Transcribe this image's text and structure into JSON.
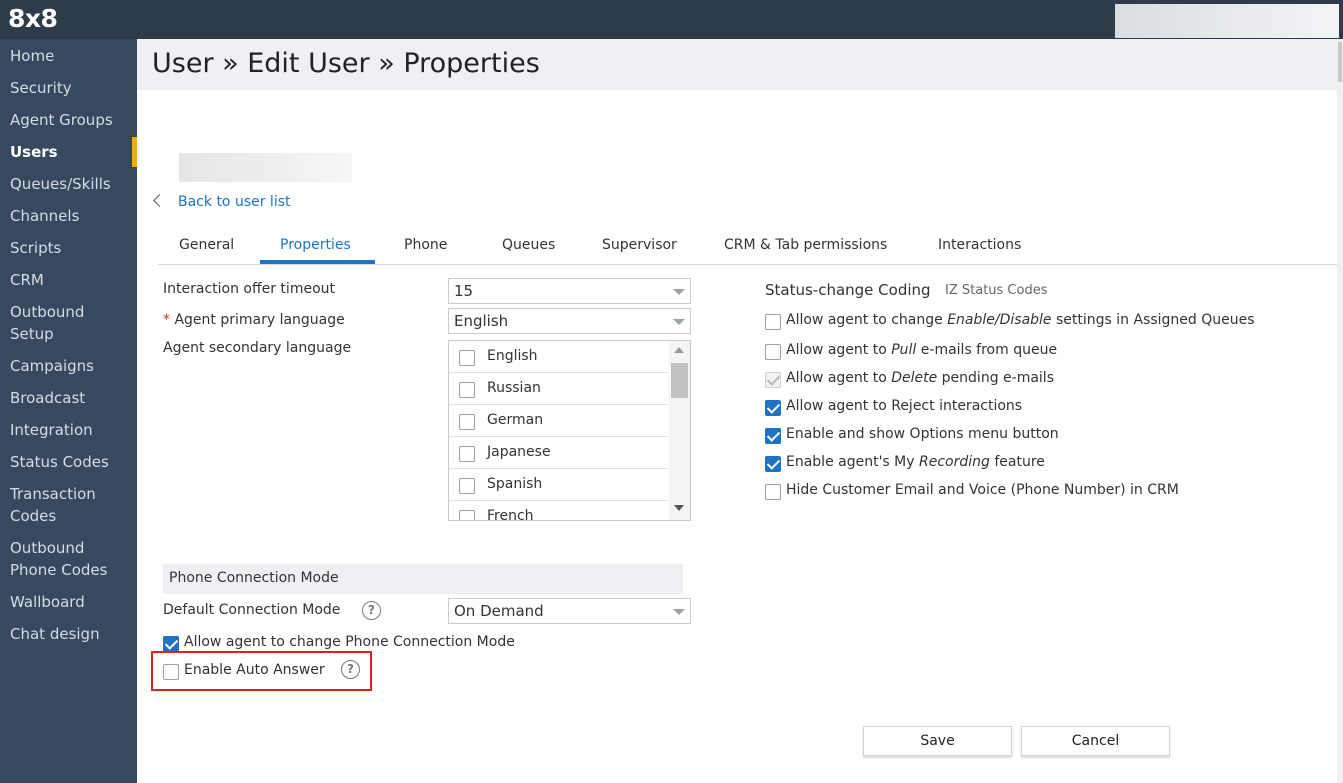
{
  "app": {
    "logo": "8x8"
  },
  "sidebar": {
    "items": [
      {
        "label": "Home"
      },
      {
        "label": "Security"
      },
      {
        "label": "Agent Groups"
      },
      {
        "label": "Users",
        "active": true
      },
      {
        "label": "Queues/Skills"
      },
      {
        "label": "Channels"
      },
      {
        "label": "Scripts"
      },
      {
        "label": "CRM"
      },
      {
        "label": "Outbound"
      },
      {
        "label": "Setup"
      },
      {
        "label": "Campaigns"
      },
      {
        "label": "Broadcast"
      },
      {
        "label": "Integration"
      },
      {
        "label": "Status Codes"
      },
      {
        "label": "Transaction"
      },
      {
        "label": "Codes"
      },
      {
        "label": "Outbound"
      },
      {
        "label": "Phone Codes"
      },
      {
        "label": "Wallboard"
      },
      {
        "label": "Chat design"
      }
    ]
  },
  "header": {
    "title": "User » Edit User » Properties"
  },
  "nav": {
    "back": "Back to user list"
  },
  "tabs": [
    {
      "label": "General"
    },
    {
      "label": "Properties",
      "active": true
    },
    {
      "label": "Phone"
    },
    {
      "label": "Queues"
    },
    {
      "label": "Supervisor"
    },
    {
      "label": "CRM & Tab permissions"
    },
    {
      "label": "Interactions"
    }
  ],
  "form": {
    "offer_timeout": {
      "label": "Interaction offer timeout",
      "value": "15"
    },
    "primary_language": {
      "required_mark": "*",
      "label": "Agent primary language",
      "value": "English"
    },
    "secondary_language": {
      "label": "Agent secondary language",
      "options": [
        {
          "label": "English",
          "checked": false
        },
        {
          "label": "Russian",
          "checked": false
        },
        {
          "label": "German",
          "checked": false
        },
        {
          "label": "Japanese",
          "checked": false
        },
        {
          "label": "Spanish",
          "checked": false
        },
        {
          "label": "French",
          "checked": false
        }
      ]
    },
    "status_coding": {
      "label": "Status-change Coding",
      "value": "IZ Status Codes"
    },
    "permissions": [
      {
        "pre": "Allow agent to change ",
        "em": "Enable/Disable",
        "post": " settings in Assigned Queues",
        "state": "unchecked"
      },
      {
        "pre": "Allow agent to ",
        "em": "Pull",
        "post": " e-mails from queue",
        "state": "unchecked"
      },
      {
        "pre": "Allow agent to ",
        "em": "Delete",
        "post": " pending e-mails",
        "state": "disabled-checked"
      },
      {
        "pre": "Allow agent to Reject interactions",
        "em": "",
        "post": "",
        "state": "checked"
      },
      {
        "pre": "Enable and show Options menu button",
        "em": "",
        "post": "",
        "state": "checked"
      },
      {
        "pre": "Enable agent's My ",
        "em": "Recording",
        "post": " feature",
        "state": "checked"
      },
      {
        "pre": "Hide Customer Email and Voice (Phone Number) in CRM",
        "em": "",
        "post": "",
        "state": "unchecked"
      }
    ]
  },
  "phone_section": {
    "title": "Phone Connection Mode",
    "default_mode": {
      "label": "Default Connection Mode",
      "value": "On Demand",
      "help": "?"
    },
    "allow_change": {
      "label": "Allow agent to change Phone Connection Mode",
      "checked": true
    },
    "auto_answer": {
      "label": "Enable Auto Answer",
      "checked": false,
      "help": "?"
    }
  },
  "buttons": {
    "save": "Save",
    "cancel": "Cancel"
  },
  "colors": {
    "sidebar": "#36495f",
    "topbar": "#2e3b4b",
    "accent": "#1f73c4",
    "active_marker": "#f5a623",
    "highlight": "#e02020"
  }
}
